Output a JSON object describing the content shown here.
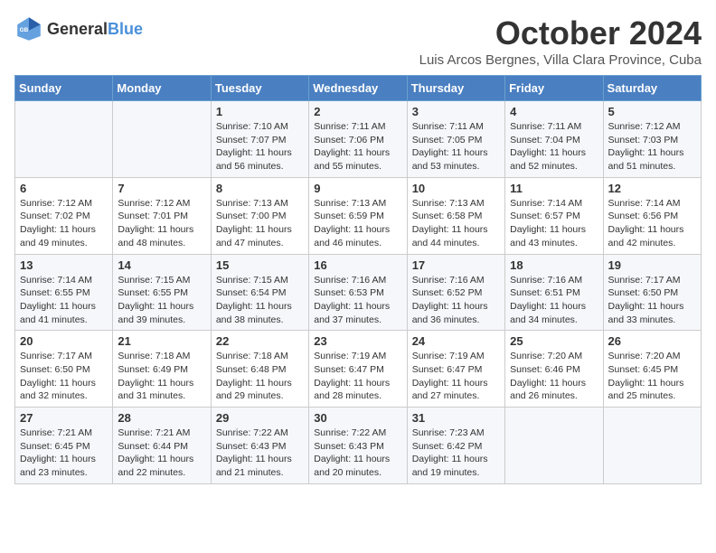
{
  "header": {
    "logo_general": "General",
    "logo_blue": "Blue",
    "month_title": "October 2024",
    "location": "Luis Arcos Bergnes, Villa Clara Province, Cuba"
  },
  "weekdays": [
    "Sunday",
    "Monday",
    "Tuesday",
    "Wednesday",
    "Thursday",
    "Friday",
    "Saturday"
  ],
  "weeks": [
    [
      {
        "day": "",
        "info": ""
      },
      {
        "day": "",
        "info": ""
      },
      {
        "day": "1",
        "info": "Sunrise: 7:10 AM\nSunset: 7:07 PM\nDaylight: 11 hours and 56 minutes."
      },
      {
        "day": "2",
        "info": "Sunrise: 7:11 AM\nSunset: 7:06 PM\nDaylight: 11 hours and 55 minutes."
      },
      {
        "day": "3",
        "info": "Sunrise: 7:11 AM\nSunset: 7:05 PM\nDaylight: 11 hours and 53 minutes."
      },
      {
        "day": "4",
        "info": "Sunrise: 7:11 AM\nSunset: 7:04 PM\nDaylight: 11 hours and 52 minutes."
      },
      {
        "day": "5",
        "info": "Sunrise: 7:12 AM\nSunset: 7:03 PM\nDaylight: 11 hours and 51 minutes."
      }
    ],
    [
      {
        "day": "6",
        "info": "Sunrise: 7:12 AM\nSunset: 7:02 PM\nDaylight: 11 hours and 49 minutes."
      },
      {
        "day": "7",
        "info": "Sunrise: 7:12 AM\nSunset: 7:01 PM\nDaylight: 11 hours and 48 minutes."
      },
      {
        "day": "8",
        "info": "Sunrise: 7:13 AM\nSunset: 7:00 PM\nDaylight: 11 hours and 47 minutes."
      },
      {
        "day": "9",
        "info": "Sunrise: 7:13 AM\nSunset: 6:59 PM\nDaylight: 11 hours and 46 minutes."
      },
      {
        "day": "10",
        "info": "Sunrise: 7:13 AM\nSunset: 6:58 PM\nDaylight: 11 hours and 44 minutes."
      },
      {
        "day": "11",
        "info": "Sunrise: 7:14 AM\nSunset: 6:57 PM\nDaylight: 11 hours and 43 minutes."
      },
      {
        "day": "12",
        "info": "Sunrise: 7:14 AM\nSunset: 6:56 PM\nDaylight: 11 hours and 42 minutes."
      }
    ],
    [
      {
        "day": "13",
        "info": "Sunrise: 7:14 AM\nSunset: 6:55 PM\nDaylight: 11 hours and 41 minutes."
      },
      {
        "day": "14",
        "info": "Sunrise: 7:15 AM\nSunset: 6:55 PM\nDaylight: 11 hours and 39 minutes."
      },
      {
        "day": "15",
        "info": "Sunrise: 7:15 AM\nSunset: 6:54 PM\nDaylight: 11 hours and 38 minutes."
      },
      {
        "day": "16",
        "info": "Sunrise: 7:16 AM\nSunset: 6:53 PM\nDaylight: 11 hours and 37 minutes."
      },
      {
        "day": "17",
        "info": "Sunrise: 7:16 AM\nSunset: 6:52 PM\nDaylight: 11 hours and 36 minutes."
      },
      {
        "day": "18",
        "info": "Sunrise: 7:16 AM\nSunset: 6:51 PM\nDaylight: 11 hours and 34 minutes."
      },
      {
        "day": "19",
        "info": "Sunrise: 7:17 AM\nSunset: 6:50 PM\nDaylight: 11 hours and 33 minutes."
      }
    ],
    [
      {
        "day": "20",
        "info": "Sunrise: 7:17 AM\nSunset: 6:50 PM\nDaylight: 11 hours and 32 minutes."
      },
      {
        "day": "21",
        "info": "Sunrise: 7:18 AM\nSunset: 6:49 PM\nDaylight: 11 hours and 31 minutes."
      },
      {
        "day": "22",
        "info": "Sunrise: 7:18 AM\nSunset: 6:48 PM\nDaylight: 11 hours and 29 minutes."
      },
      {
        "day": "23",
        "info": "Sunrise: 7:19 AM\nSunset: 6:47 PM\nDaylight: 11 hours and 28 minutes."
      },
      {
        "day": "24",
        "info": "Sunrise: 7:19 AM\nSunset: 6:47 PM\nDaylight: 11 hours and 27 minutes."
      },
      {
        "day": "25",
        "info": "Sunrise: 7:20 AM\nSunset: 6:46 PM\nDaylight: 11 hours and 26 minutes."
      },
      {
        "day": "26",
        "info": "Sunrise: 7:20 AM\nSunset: 6:45 PM\nDaylight: 11 hours and 25 minutes."
      }
    ],
    [
      {
        "day": "27",
        "info": "Sunrise: 7:21 AM\nSunset: 6:45 PM\nDaylight: 11 hours and 23 minutes."
      },
      {
        "day": "28",
        "info": "Sunrise: 7:21 AM\nSunset: 6:44 PM\nDaylight: 11 hours and 22 minutes."
      },
      {
        "day": "29",
        "info": "Sunrise: 7:22 AM\nSunset: 6:43 PM\nDaylight: 11 hours and 21 minutes."
      },
      {
        "day": "30",
        "info": "Sunrise: 7:22 AM\nSunset: 6:43 PM\nDaylight: 11 hours and 20 minutes."
      },
      {
        "day": "31",
        "info": "Sunrise: 7:23 AM\nSunset: 6:42 PM\nDaylight: 11 hours and 19 minutes."
      },
      {
        "day": "",
        "info": ""
      },
      {
        "day": "",
        "info": ""
      }
    ]
  ]
}
